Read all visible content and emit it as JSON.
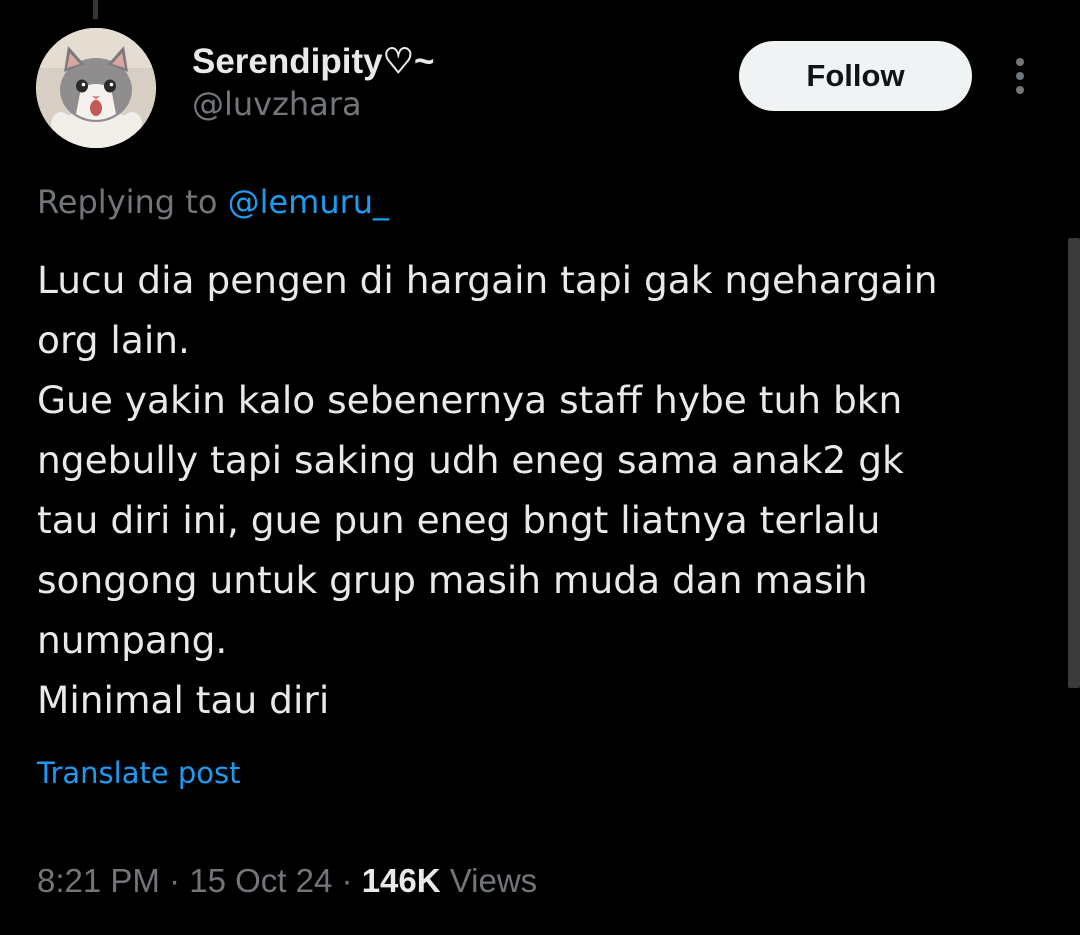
{
  "user": {
    "display_name": "Serendipity♡~",
    "handle": "@luvzhara"
  },
  "actions": {
    "follow_label": "Follow",
    "more_icon": "vertical-ellipsis-icon"
  },
  "reply": {
    "prefix": "Replying to",
    "mention": "@lemuru_"
  },
  "tweet": {
    "lines": [
      "Lucu dia pengen di hargain tapi gak ngehargain",
      "org lain.",
      "Gue yakin kalo sebenernya staff hybe tuh bkn",
      "ngebully tapi saking udh eneg sama anak2 gk",
      "tau diri ini, gue pun eneg bngt liatnya terlalu",
      "songong untuk grup masih muda dan masih",
      "numpang.",
      "Minimal tau diri"
    ]
  },
  "translate_label": "Translate post",
  "meta": {
    "time": "8:21 PM",
    "separator": "·",
    "date": "15 Oct 24",
    "views_count": "146K",
    "views_label": "Views"
  },
  "colors": {
    "background": "#000000",
    "text": "#e7e9ea",
    "secondary": "#71767b",
    "link": "#1d9bf0",
    "button_bg": "#eff3f4"
  }
}
